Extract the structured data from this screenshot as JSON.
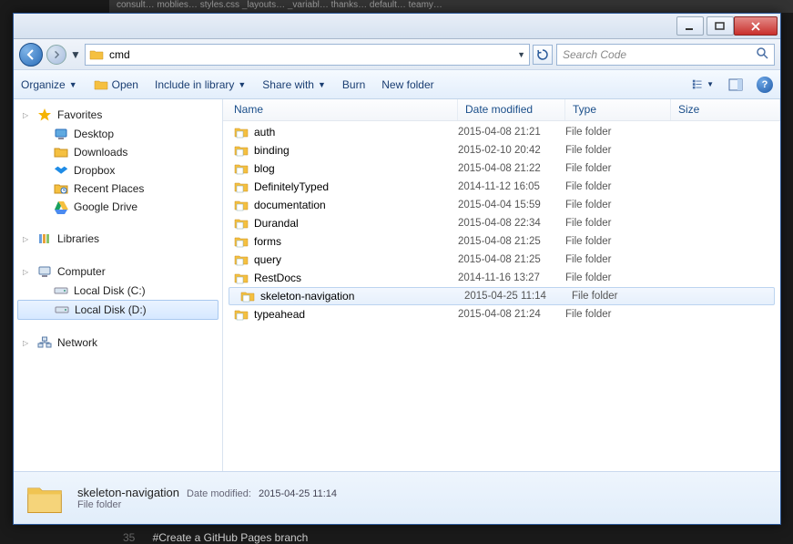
{
  "background": {
    "tabs_hint": "consult…  moblies…  styles.css  _layouts…  _variabl…  thanks…  default…  teamy…",
    "bottom_line_num": "35",
    "bottom_line": "#Create a GitHub Pages branch"
  },
  "address": {
    "value": "cmd"
  },
  "search": {
    "placeholder": "Search Code"
  },
  "toolbar": {
    "organize": "Organize",
    "open": "Open",
    "include": "Include in library",
    "share": "Share with",
    "burn": "Burn",
    "newfolder": "New folder"
  },
  "sidebar": {
    "favorites": {
      "label": "Favorites",
      "items": [
        {
          "label": "Desktop"
        },
        {
          "label": "Downloads"
        },
        {
          "label": "Dropbox"
        },
        {
          "label": "Recent Places"
        },
        {
          "label": "Google Drive"
        }
      ]
    },
    "libraries": {
      "label": "Libraries"
    },
    "computer": {
      "label": "Computer",
      "items": [
        {
          "label": "Local Disk (C:)"
        },
        {
          "label": "Local Disk (D:)",
          "selected": true
        }
      ]
    },
    "network": {
      "label": "Network"
    }
  },
  "columns": {
    "name": "Name",
    "date": "Date modified",
    "type": "Type",
    "size": "Size"
  },
  "files": [
    {
      "name": "auth",
      "date": "2015-04-08 21:21",
      "type": "File folder"
    },
    {
      "name": "binding",
      "date": "2015-02-10 20:42",
      "type": "File folder"
    },
    {
      "name": "blog",
      "date": "2015-04-08 21:22",
      "type": "File folder"
    },
    {
      "name": "DefinitelyTyped",
      "date": "2014-11-12 16:05",
      "type": "File folder"
    },
    {
      "name": "documentation",
      "date": "2015-04-04 15:59",
      "type": "File folder"
    },
    {
      "name": "Durandal",
      "date": "2015-04-08 22:34",
      "type": "File folder"
    },
    {
      "name": "forms",
      "date": "2015-04-08 21:25",
      "type": "File folder"
    },
    {
      "name": "query",
      "date": "2015-04-08 21:25",
      "type": "File folder"
    },
    {
      "name": "RestDocs",
      "date": "2014-11-16 13:27",
      "type": "File folder"
    },
    {
      "name": "skeleton-navigation",
      "date": "2015-04-25 11:14",
      "type": "File folder",
      "selected": true
    },
    {
      "name": "typeahead",
      "date": "2015-04-08 21:24",
      "type": "File folder"
    }
  ],
  "details": {
    "name": "skeleton-navigation",
    "date_label": "Date modified:",
    "date": "2015-04-25 11:14",
    "type": "File folder"
  }
}
